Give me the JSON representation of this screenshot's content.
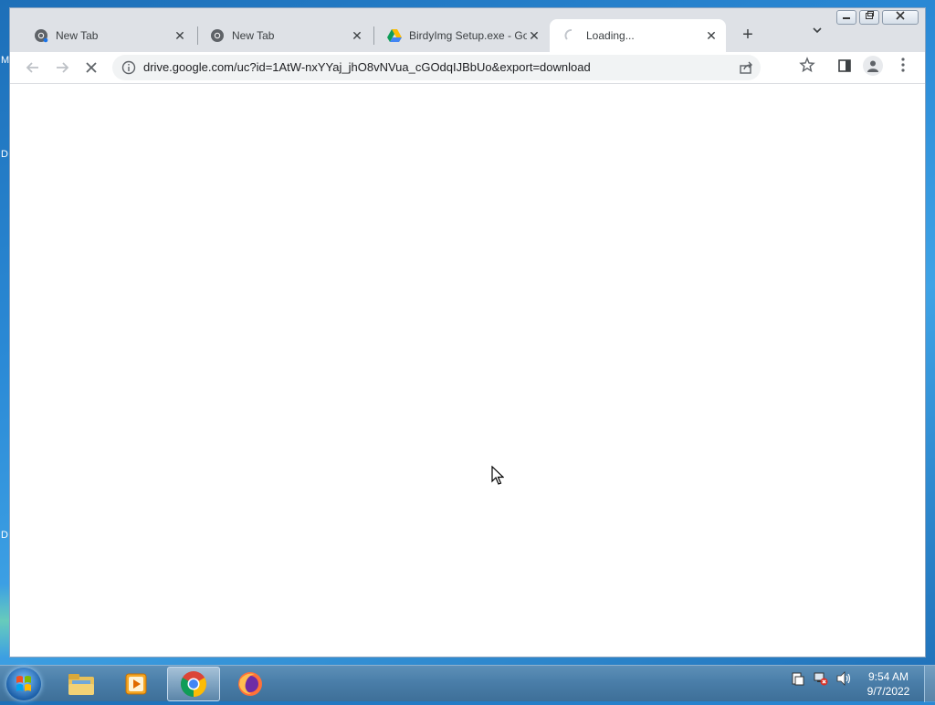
{
  "desktop": {
    "fragments": [
      "M",
      "D",
      "D"
    ]
  },
  "browser": {
    "tabs": [
      {
        "title": "New Tab",
        "icon": "chrome-icon",
        "active": false
      },
      {
        "title": "New Tab",
        "icon": "chrome-icon",
        "active": false
      },
      {
        "title": "BirdyImg Setup.exe - Go",
        "icon": "google-drive-icon",
        "active": false
      },
      {
        "title": "Loading...",
        "icon": "loading-spinner-icon",
        "active": true
      }
    ],
    "url": "drive.google.com/uc?id=1AtW-nxYYaj_jhO8vNVua_cGOdqIJBbUo&export=download"
  },
  "taskbar": {
    "apps": [
      "windows-explorer",
      "media-player",
      "google-chrome",
      "firefox"
    ],
    "clock": {
      "time": "9:54 AM",
      "date": "9/7/2022"
    }
  }
}
